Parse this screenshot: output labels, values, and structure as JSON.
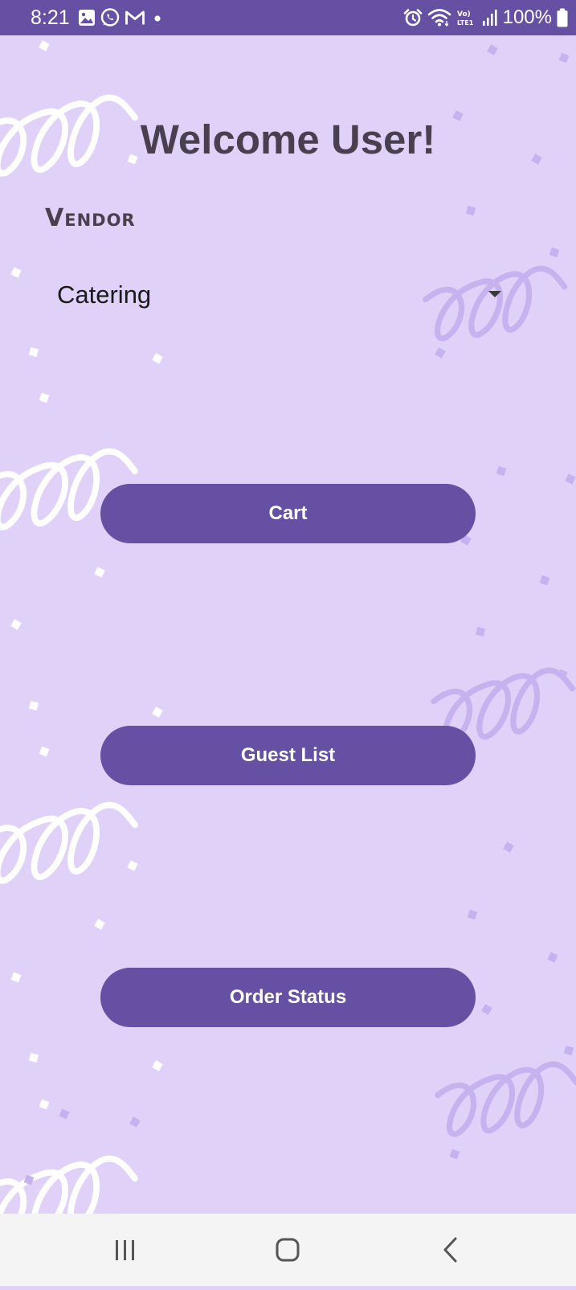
{
  "status_bar": {
    "time": "8:21",
    "battery_percent": "100%",
    "left_icons": [
      "gallery-icon",
      "whatsapp-icon",
      "gmail-icon",
      "notification-dot-icon"
    ],
    "right_icons": [
      "alarm-icon",
      "wifi-icon",
      "volte-lte-icon",
      "signal-icon",
      "battery-icon"
    ]
  },
  "header": {
    "title": "Welcome User!"
  },
  "vendor": {
    "label": "Vendor",
    "selected_value": "Catering"
  },
  "buttons": {
    "cart": "Cart",
    "guest_list": "Guest List",
    "order_status": "Order Status"
  },
  "navigation": {
    "items": [
      "recent-apps-icon",
      "home-icon",
      "back-icon"
    ]
  },
  "colors": {
    "background": "#E0D1F9",
    "primary": "#6650A4",
    "title_text": "#48404F",
    "nav_bar": "#F4F4F5",
    "swirl_light": "#FFFFFF",
    "swirl_purple": "#C7B2F0"
  }
}
